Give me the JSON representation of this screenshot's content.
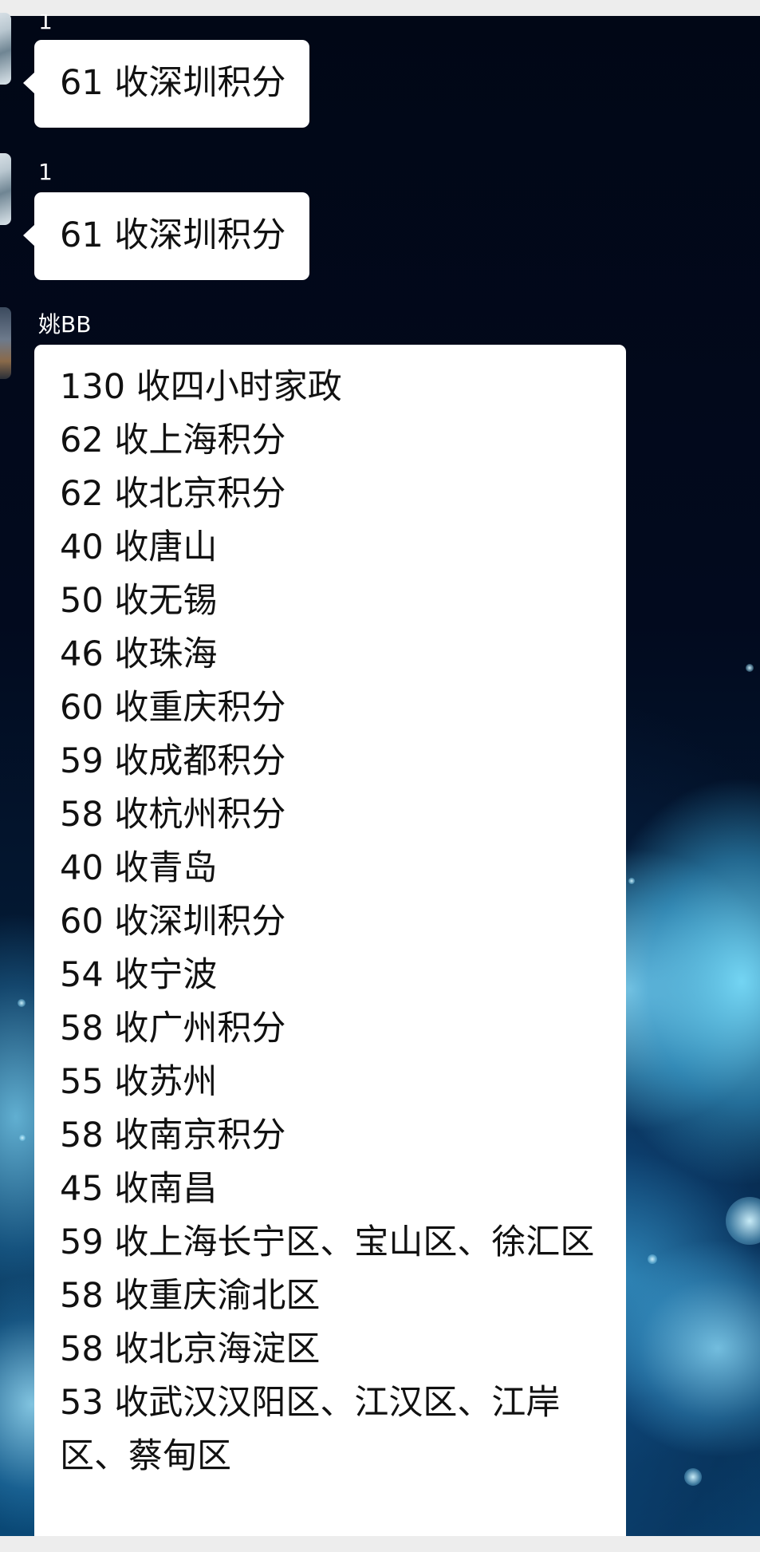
{
  "messages": [
    {
      "sender": "1",
      "text": "61 收深圳积分"
    },
    {
      "sender": "1",
      "text": "61 收深圳积分"
    },
    {
      "sender": "姚BB",
      "lines": [
        "130 收四小时家政",
        "62 收上海积分",
        "62 收北京积分",
        "40 收唐山",
        "50 收无锡",
        "46 收珠海",
        "60 收重庆积分",
        "59 收成都积分",
        "58 收杭州积分",
        "40 收青岛",
        "60 收深圳积分",
        "54 收宁波",
        "58 收广州积分",
        "55 收苏州",
        "58 收南京积分",
        "45 收南昌",
        "59 收上海长宁区、宝山区、徐汇区",
        "58 收重庆渝北区",
        "58 收北京海淀区",
        "53 收武汉汉阳区、江汉区、江岸区、蔡甸区"
      ]
    }
  ],
  "colors": {
    "bubble": "#ffffff",
    "text": "#111111",
    "sender_name": "#ffffff",
    "background_top": "#010716",
    "background_bokeh": "#78dcfa"
  }
}
